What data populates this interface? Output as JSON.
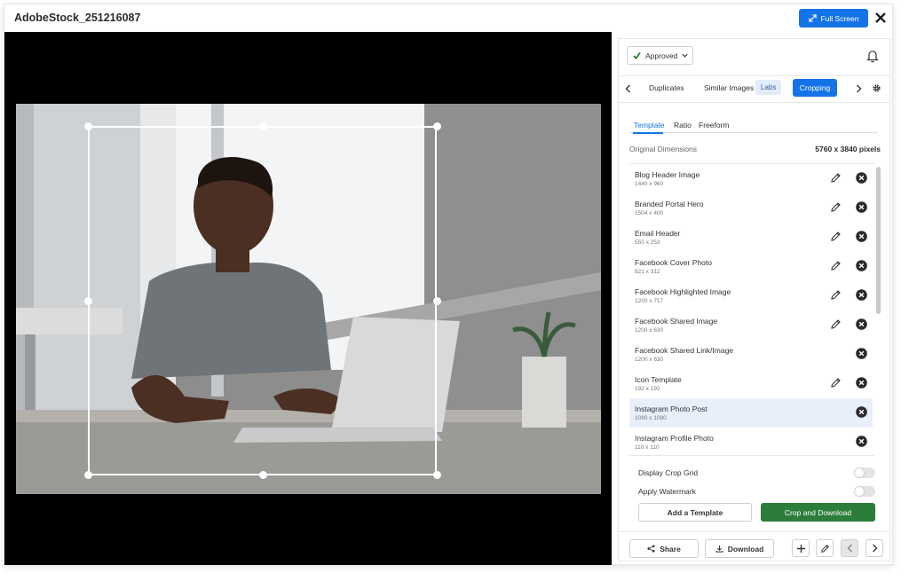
{
  "window": {
    "title": "AdobeStock_251216087",
    "fullscreen_label": "Full Screen"
  },
  "panel": {
    "status": {
      "label": "Approved"
    },
    "tabs": {
      "duplicates": "Duplicates",
      "similar": "Similar Images",
      "labs": "Labs",
      "cropping": "Cropping"
    },
    "subtabs": {
      "template": "Template",
      "ratio": "Ratio",
      "freeform": "Freeform"
    },
    "original": {
      "label": "Original Dimensions",
      "value": "5760 x 3840 pixels"
    },
    "templates": [
      {
        "name": "Blog Header Image",
        "size": "1440 x 960",
        "editable": true
      },
      {
        "name": "Branded Portal Hero",
        "size": "1504 x 400",
        "editable": true
      },
      {
        "name": "Email Header",
        "size": "550 x 253",
        "editable": true
      },
      {
        "name": "Facebook Cover Photo",
        "size": "821 x 312",
        "editable": true
      },
      {
        "name": "Facebook Highlighted Image",
        "size": "1200 x 717",
        "editable": true
      },
      {
        "name": "Facebook Shared Image",
        "size": "1200 x 630",
        "editable": true
      },
      {
        "name": "Facebook Shared Link/Image",
        "size": "1200 x 630",
        "editable": false
      },
      {
        "name": "Icon Template",
        "size": "192 x 192",
        "editable": true
      },
      {
        "name": "Instagram Photo Post",
        "size": "1080 x 1080",
        "editable": false
      },
      {
        "name": "Instagram Profile Photo",
        "size": "110 x 110",
        "editable": false
      }
    ],
    "selected_template": "Instagram Photo Post",
    "toggles": {
      "crop_grid": "Display Crop Grid",
      "watermark": "Apply Watermark"
    },
    "add_template": "Add a Template",
    "crop_download": "Crop and Download",
    "share": "Share",
    "download": "Download"
  },
  "colors": {
    "accent": "#1473e6",
    "green": "#2d7d3a",
    "selected_row": "#e8effa"
  }
}
